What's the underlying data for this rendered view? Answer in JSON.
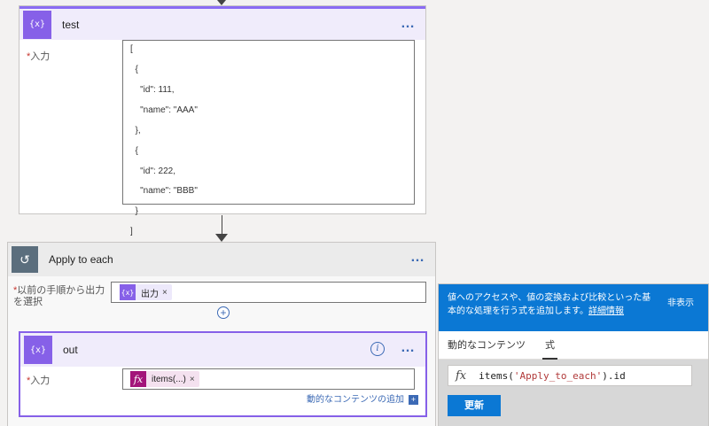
{
  "test_action": {
    "title": "test",
    "more_label": "…",
    "input_label": "入力",
    "json_lines": [
      "[",
      "  {",
      "    \"id\": 111,",
      "    \"name\": \"AAA\"",
      "  },",
      "  {",
      "    \"id\": 222,",
      "    \"name\": \"BBB\"",
      "  }",
      "]"
    ]
  },
  "apply_to_each": {
    "title": "Apply to each",
    "more_label": "…",
    "select_label_1": "以前の手順から出力",
    "select_label_2": "を選択",
    "token_label": "出力",
    "token_close": "×",
    "add_label": "+"
  },
  "out_action": {
    "title": "out",
    "more_label": "…",
    "info_label": "i",
    "input_label": "入力",
    "token_label": "items(...)",
    "token_close": "×",
    "dynamic_content_link": "動的なコンテンツの追加",
    "dynamic_content_plus": "+"
  },
  "expression_panel": {
    "description_1": "値へのアクセスや、値の変換および比較といった基",
    "description_2": "本的な処理を行う式を追加します。",
    "details_link": "詳細情報",
    "hide_label": "非表示",
    "tab_dynamic": "動的なコンテンツ",
    "tab_expression": "式",
    "fx_label": "fx",
    "expr_func": "items(",
    "expr_arg": "'Apply_to_each'",
    "expr_tail": ").id",
    "update_button": "更新"
  },
  "colors": {
    "variable_purple": "#8660e8",
    "accent_blue": "#0b78d4",
    "expression_magenta": "#a3157a"
  }
}
